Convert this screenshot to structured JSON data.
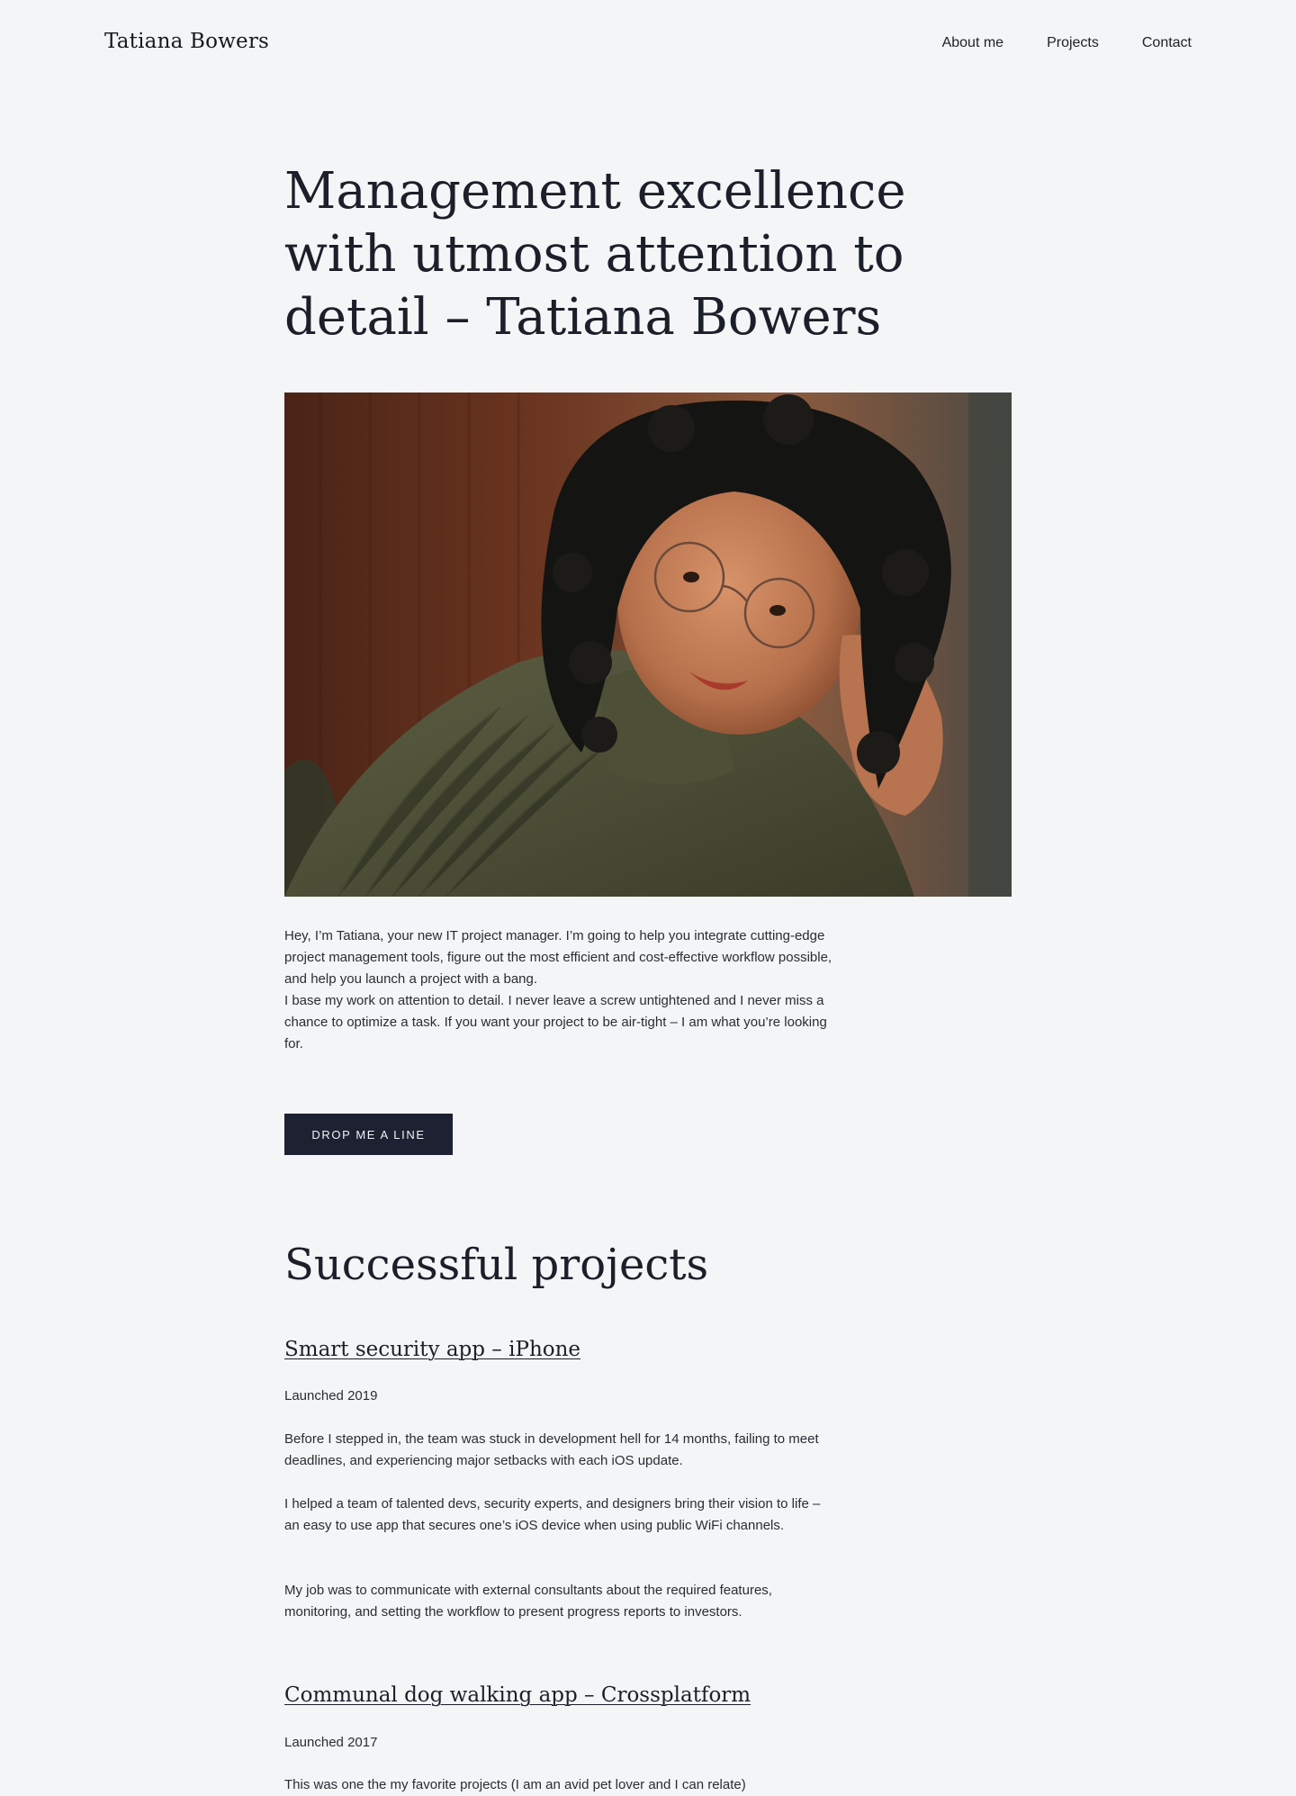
{
  "header": {
    "site_title": "Tatiana Bowers",
    "nav": [
      {
        "label": "About me"
      },
      {
        "label": "Projects"
      },
      {
        "label": "Contact"
      }
    ]
  },
  "hero": {
    "title": "Management excellence with utmost attention to detail – Tatiana Bowers",
    "image_description": "portrait-photo",
    "intro_line1": "Hey, I’m Tatiana, your new IT project manager. I’m going to help you integrate cutting-edge project management tools, figure out the most efficient and cost-effective workflow possible, and help you launch a project with a bang.",
    "intro_line2": "I base my work on attention to detail. I never leave a screw untightened and I never miss a chance to optimize a task. If you want your project to be air-tight – I am what you’re looking for.",
    "cta_label": "DROP ME A LINE"
  },
  "projects": {
    "section_title": "Successful projects",
    "items": [
      {
        "title": "Smart security app – iPhone",
        "launched": "Launched 2019",
        "paragraphs": [
          "Before I stepped in, the team was stuck in development hell for 14 months, failing to meet deadlines, and experiencing major setbacks with each iOS update.",
          "I helped a team of talented devs, security experts, and designers bring their vision to life – an easy to use app that secures one’s iOS device when using public WiFi channels.",
          "My job was to communicate with external consultants about the required features, monitoring, and setting the workflow to present progress reports to investors."
        ]
      },
      {
        "title": "Communal dog walking app – Crossplatform",
        "launched": "Launched 2017",
        "paragraphs": [
          "This was one the my favorite projects (I am an avid pet lover and I can relate)"
        ]
      }
    ]
  },
  "colors": {
    "background": "#f3f5f7",
    "text": "#1d2129",
    "button": "#1e2131",
    "button_text": "#f1f2f6"
  }
}
